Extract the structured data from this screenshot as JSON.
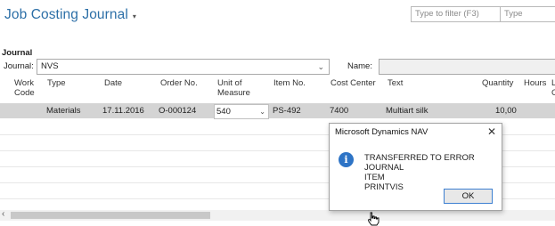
{
  "page": {
    "title": "Job Costing Journal",
    "filter_placeholder": "Type to filter (F3)",
    "filter_field": "Type"
  },
  "journal": {
    "section_title": "Journal",
    "journal_label": "Journal:",
    "journal_value": "NVS",
    "name_label": "Name:"
  },
  "grid": {
    "headers": [
      "Work\nCode",
      "Type",
      "Date",
      "Order No.",
      "Unit of\nMeasure",
      "Item No.",
      "Cost Center",
      "Text",
      "Quantity",
      "Hours",
      "L\nC"
    ],
    "rows": [
      {
        "work_code": "",
        "type": "Materials",
        "date": "17.11.2016",
        "order_no": "O-000124",
        "unit_of_measure": "540",
        "item_no": "PS-492",
        "cost_center": "7400",
        "text": "Multiart silk",
        "quantity": "10,00",
        "hours": ""
      }
    ]
  },
  "dialog": {
    "title": "Microsoft Dynamics NAV",
    "icon": "info-icon",
    "message_line1": "TRANSFERRED TO ERROR JOURNAL",
    "message_line2": "ITEM",
    "message_line3": "PRINTVIS",
    "ok_label": "OK"
  },
  "colors": {
    "title_blue": "#2c6fa7",
    "selected_row": "#d4d4d4",
    "info_icon": "#2e74c6",
    "focus_border": "#3c7fd1"
  }
}
